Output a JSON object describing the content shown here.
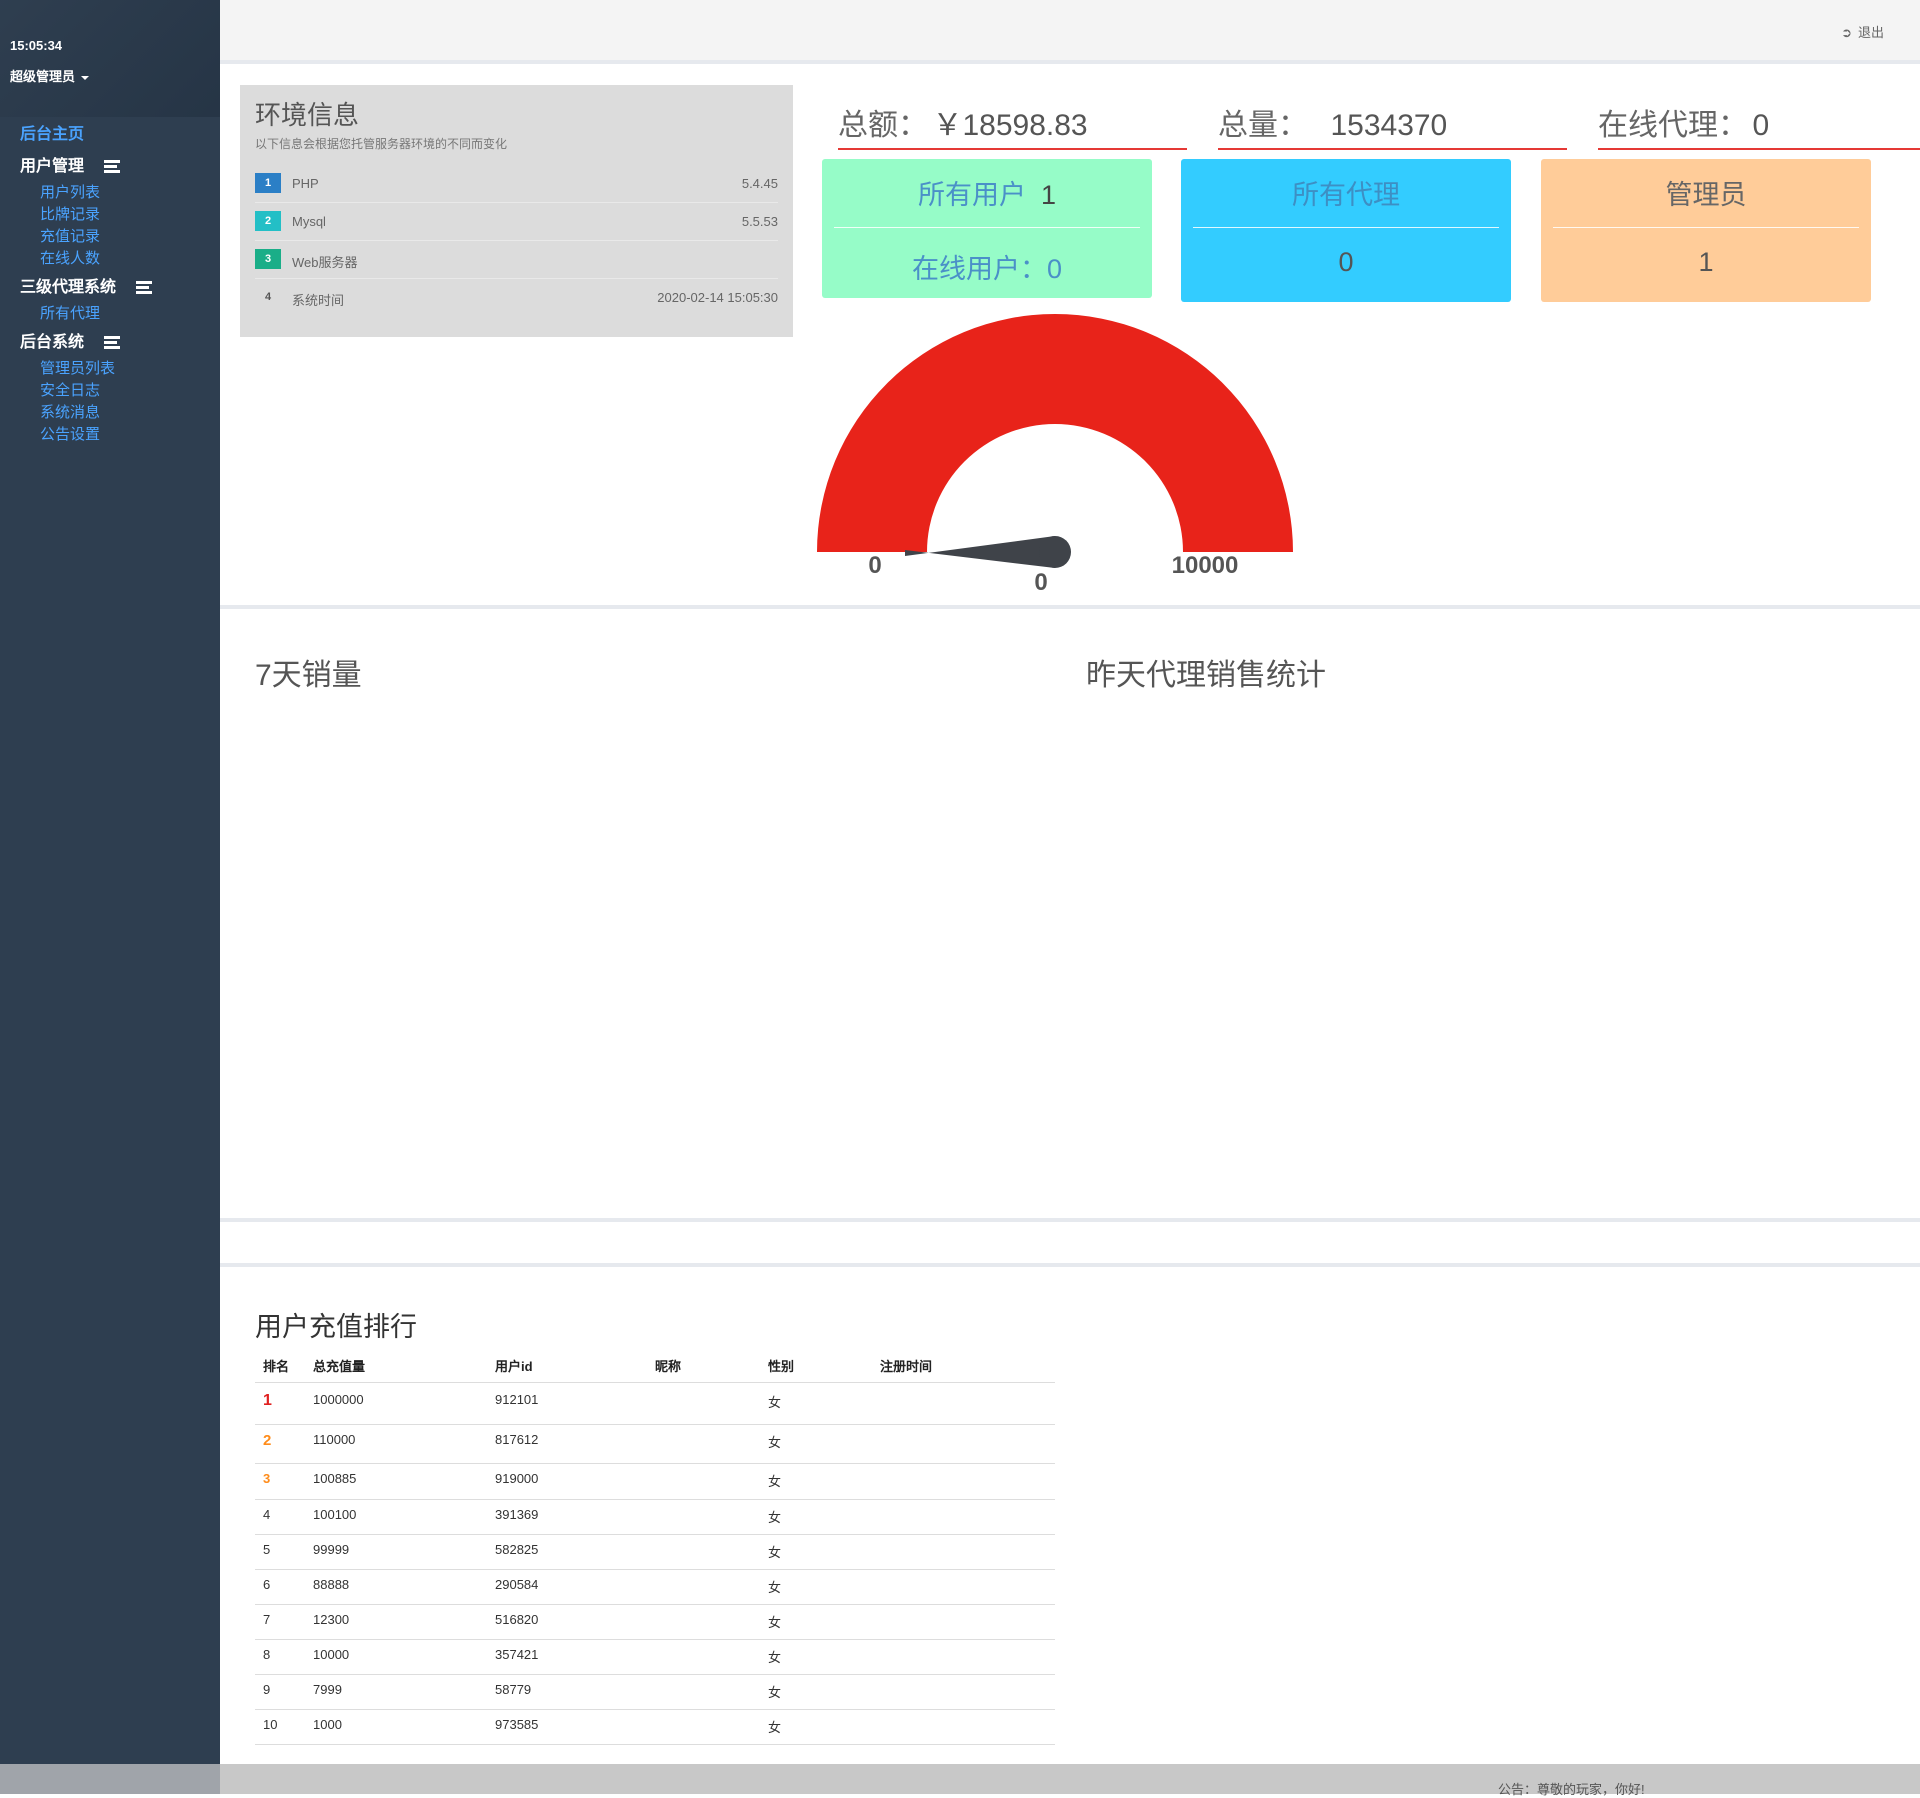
{
  "sidebar": {
    "clock": "15:05:34",
    "admin": "超级管理员",
    "home": "后台主页",
    "groups": [
      {
        "label": "用户管理",
        "items": [
          "用户列表",
          "比牌记录",
          "充值记录",
          "在线人数"
        ]
      },
      {
        "label": "三级代理系统",
        "items": [
          "所有代理"
        ]
      },
      {
        "label": "后台系统",
        "items": [
          "管理员列表",
          "安全日志",
          "系统消息",
          "公告设置"
        ]
      }
    ]
  },
  "topbar": {
    "logout": "退出"
  },
  "env": {
    "title": "环境信息",
    "subtitle": "以下信息会根据您托管服务器环境的不同而变化",
    "rows": [
      {
        "num": "1",
        "name": "PHP",
        "value": "5.4.45",
        "color": "#2b7fc6"
      },
      {
        "num": "2",
        "name": "Mysql",
        "value": "5.5.53",
        "color": "#23bfc6"
      },
      {
        "num": "3",
        "name": "Web服务器",
        "value": "",
        "color": "#1aae88"
      },
      {
        "num": "4",
        "name": "系统时间",
        "value": "2020-02-14 15:05:30",
        "color": ""
      }
    ]
  },
  "totals": [
    {
      "label": "总额：",
      "value": "￥18598.83"
    },
    {
      "label": "总量：",
      "value": "1534370"
    },
    {
      "label": "在线代理：",
      "value": "0"
    }
  ],
  "cards": [
    {
      "label": "所有用户",
      "value": "1",
      "label2": "在线用户：",
      "value2": "0",
      "color": "#96fcc8"
    },
    {
      "label": "所有代理",
      "value2": "0",
      "color": "#33ccff"
    },
    {
      "label": "管理员",
      "value2": "1",
      "color": "#ffcc99"
    }
  ],
  "gauge": {
    "min": "0",
    "max": "10000",
    "value": "0",
    "value_fraction": 0,
    "color": "#e8231a"
  },
  "sections": {
    "sales7": "7天销量",
    "agentYesterday": "昨天代理销售统计"
  },
  "ranking": {
    "title": "用户充值排行",
    "headers": [
      "排名",
      "总充值量",
      "用户id",
      "昵称",
      "性别",
      "注册时间"
    ],
    "rows": [
      [
        "1",
        "1000000",
        "912101",
        "",
        "女",
        ""
      ],
      [
        "2",
        "110000",
        "817612",
        "",
        "女",
        ""
      ],
      [
        "3",
        "100885",
        "919000",
        "",
        "女",
        ""
      ],
      [
        "4",
        "100100",
        "391369",
        "",
        "女",
        ""
      ],
      [
        "5",
        "99999",
        "582825",
        "",
        "女",
        ""
      ],
      [
        "6",
        "88888",
        "290584",
        "",
        "女",
        ""
      ],
      [
        "7",
        "12300",
        "516820",
        "",
        "女",
        ""
      ],
      [
        "8",
        "10000",
        "357421",
        "",
        "女",
        ""
      ],
      [
        "9",
        "7999",
        "58779",
        "",
        "女",
        ""
      ],
      [
        "10",
        "1000",
        "973585",
        "",
        "女",
        ""
      ]
    ]
  },
  "footer": {
    "notice": "公告：尊敬的玩家，你好!"
  }
}
